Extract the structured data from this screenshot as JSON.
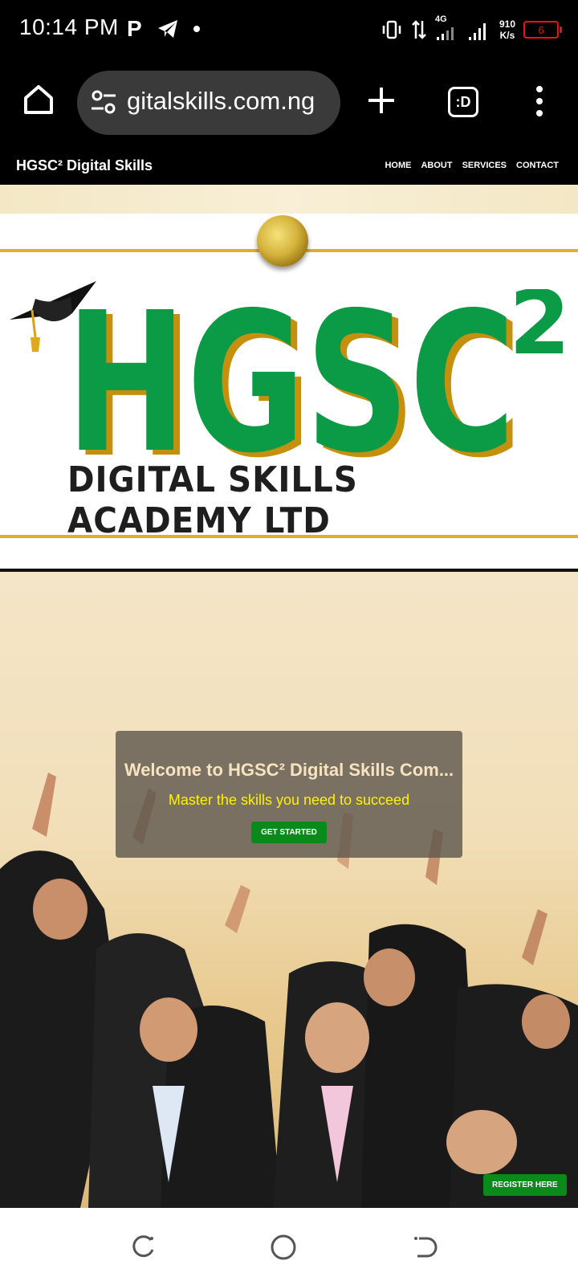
{
  "status_bar": {
    "time": "10:14 PM",
    "network_type": "4G",
    "net_speed_value": "910",
    "net_speed_unit": "K/s",
    "battery_level": "6",
    "icons": [
      "parking-icon",
      "telegram-icon",
      "dot-icon",
      "vibrate-icon",
      "data-arrows-icon",
      "signal-icon",
      "battery-icon"
    ]
  },
  "browser": {
    "url": "gitalskills.com.ng",
    "tabs_label": ":D"
  },
  "site": {
    "title": "HGSC² Digital Skills",
    "nav": [
      "HOME",
      "ABOUT",
      "SERVICES",
      "CONTACT"
    ]
  },
  "logo": {
    "letters": "HGSC",
    "superscript": "2",
    "subtitle": "DIGITAL SKILLS ACADEMY LTD",
    "colors": {
      "green": "#0b9a45",
      "gold": "#e4ac2a",
      "dark": "#1e1e1e"
    }
  },
  "hero": {
    "title": "Welcome to HGSC² Digital Skills Com...",
    "subtitle": "Master the skills you need to succeed",
    "cta": "GET STARTED",
    "register": "REGISTER HERE",
    "colors": {
      "button": "#0a8a1a",
      "subtitle": "#fff200"
    }
  }
}
